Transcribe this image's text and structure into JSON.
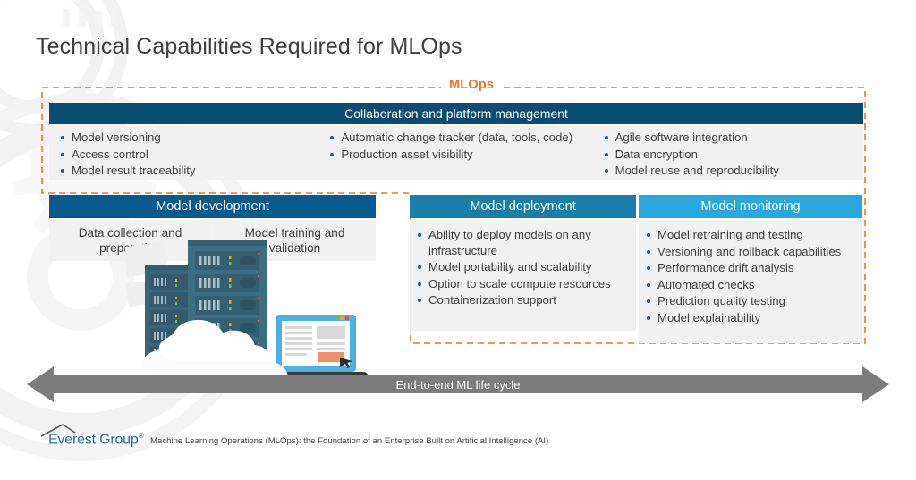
{
  "page": {
    "title": "Technical Capabilities Required for MLOps",
    "region_label": "MLOps"
  },
  "colors": {
    "orange_dashed": "#ef7622",
    "navy_header": "#0b4d70",
    "dev_header": "#08598c",
    "deploy_header": "#1a7fa8",
    "monitor_header": "#29a8e0",
    "panel_bg": "#f1f1f1",
    "arrow_gray": "#7c7c7c",
    "bullet_blue": "#1b5e88",
    "text_gray": "#3f3f3f",
    "logo_blue": "#2e6ca4"
  },
  "collaboration": {
    "header": "Collaboration and platform management",
    "columns": [
      [
        "Model versioning",
        "Access control",
        "Model result traceability"
      ],
      [
        "Automatic change tracker (data, tools, code)",
        "Production asset visibility"
      ],
      [
        "Agile software integration",
        "Data encryption",
        "Model reuse and reproducibility"
      ]
    ]
  },
  "model_development": {
    "header": "Model development",
    "cells": [
      "Data collection and preparation",
      "Model training and validation"
    ]
  },
  "model_deployment": {
    "header": "Model deployment",
    "bullets": [
      "Ability to deploy models on any infrastructure",
      "Model portability and scalability",
      "Option to scale compute resources",
      "Containerization support"
    ]
  },
  "model_monitoring": {
    "header": "Model monitoring",
    "bullets": [
      "Model retraining and testing",
      "Versioning and rollback capabilities",
      "Performance drift analysis",
      "Automated checks",
      "Prediction quality testing",
      "Model explainability"
    ]
  },
  "lifecycle_arrow": {
    "label": "End-to-end ML life cycle"
  },
  "footer": {
    "logo_name": "Everest Group",
    "logo_mark": "®",
    "caption": "Machine Learning Operations (MLOps): the Foundation of an Enterprise Built on Artificial Intelligence (AI)"
  },
  "illustration": {
    "items": [
      "server-rack-small",
      "server-rack-large",
      "cloud",
      "laptop"
    ]
  }
}
